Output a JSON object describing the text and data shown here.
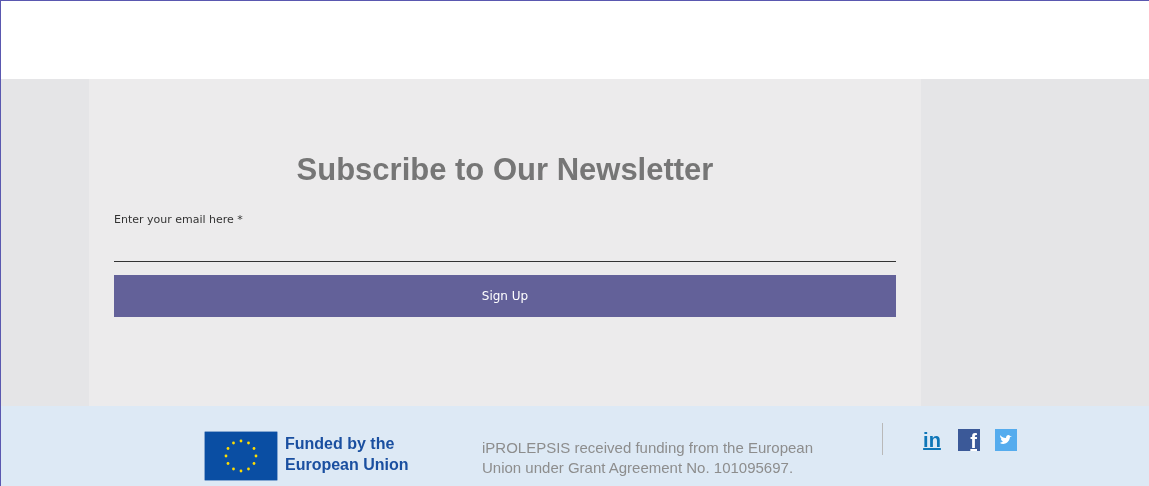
{
  "newsletter": {
    "title": "Subscribe to Our Newsletter",
    "email_label": "Enter your email here *",
    "button": "Sign Up"
  },
  "footer": {
    "funded_label": "Funded by the European Union",
    "funding_text": "iPROLEPSIS received funding from the European Union under Grant Agreement No. 101095697.",
    "social": [
      {
        "kind": "linkedin",
        "glyph": "in"
      },
      {
        "kind": "facebook",
        "glyph": "f"
      },
      {
        "kind": "twitter"
      }
    ]
  }
}
